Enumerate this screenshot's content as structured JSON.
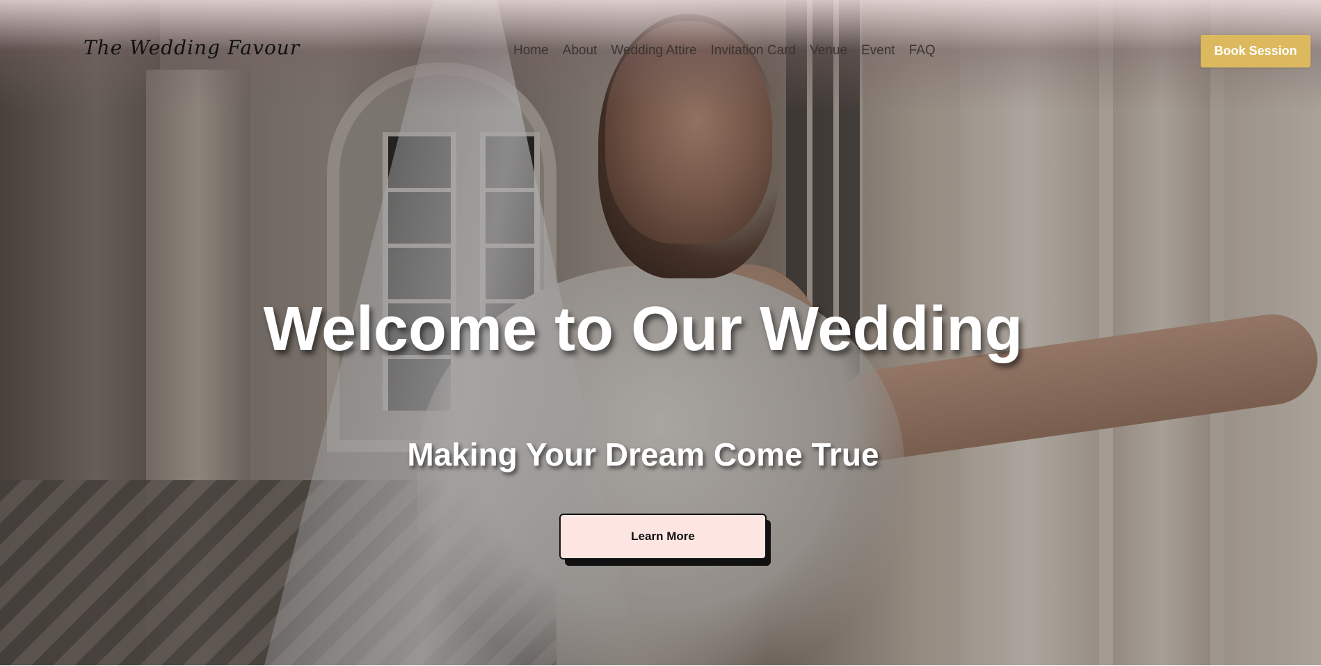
{
  "brand": {
    "logo_text": "The Wedding Favour"
  },
  "nav": {
    "links": [
      {
        "label": "Home"
      },
      {
        "label": "About"
      },
      {
        "label": "Wedding Attire"
      },
      {
        "label": "Invitation Card"
      },
      {
        "label": "Venue"
      },
      {
        "label": "Event"
      },
      {
        "label": "FAQ"
      }
    ],
    "cta_label": "Book Session"
  },
  "hero": {
    "title": "Welcome to Our Wedding",
    "subtitle": "Making Your Dream Come True",
    "button_label": "Learn More",
    "background_image": "bride-in-veil-photo"
  },
  "colors": {
    "accent_gold": "#dcb95e",
    "button_pink": "#fde6e2",
    "text_dark": "#111111",
    "nav_text": "#3a3433"
  }
}
